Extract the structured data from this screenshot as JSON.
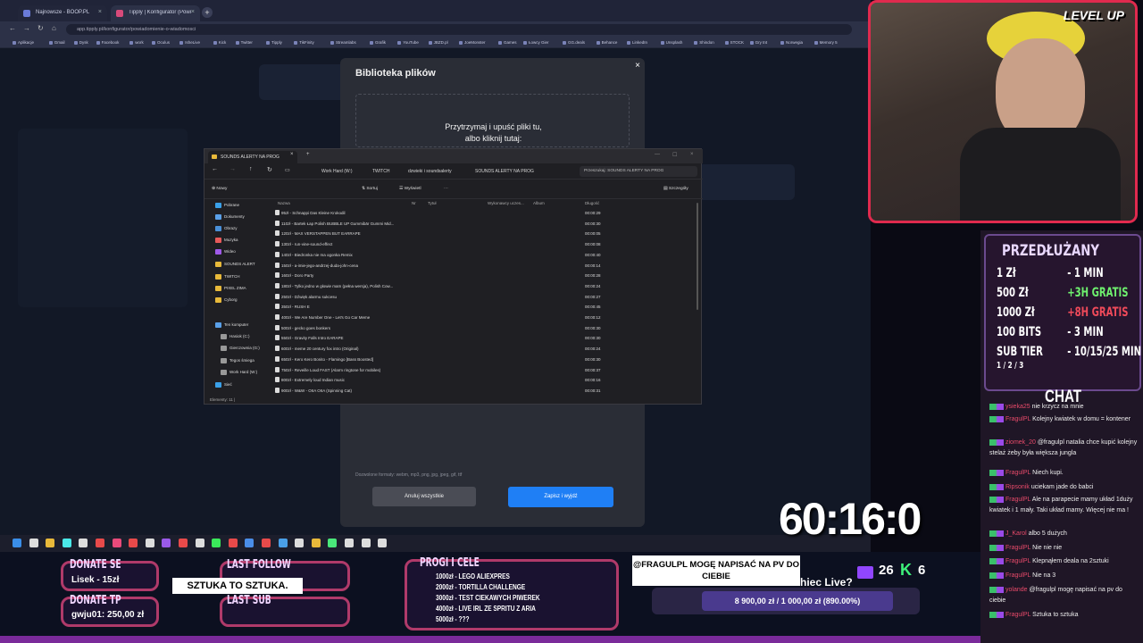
{
  "browser": {
    "tabs": [
      {
        "label": "Najnowsze - BOOP.PL"
      },
      {
        "label": "Tipply | Konfigurator (Powiadomienia)"
      }
    ],
    "url": "app.tipply.pl/konfigurator/powiadomienie-o-wiadomosci",
    "bookmarks": [
      "Aplikacje",
      "Gmail",
      "Dysk",
      "Facebook",
      "work",
      "Oculus",
      "IsheLive",
      "Kick",
      "Twitter",
      "Tipply",
      "TikFinity",
      "Streamlabs",
      "Grafik",
      "YouTube",
      "JBZD.pl",
      "JoeMonster",
      "Games",
      "Łowcy Gier",
      "GG.deals",
      "Behance",
      "LinkedIn",
      "Unsplash",
      "Shindon",
      "STOCK",
      "Gry tnt",
      "Norwegia",
      "Memory 5"
    ]
  },
  "modal": {
    "title": "Biblioteka plików",
    "close": "×",
    "drop_line1": "Przytrzymaj i upuść pliki tu,",
    "drop_line2": "albo kliknij tutaj:",
    "formats": "Dozwolone formaty: webm, mp3, png, jpg, jpeg, gif, ttf",
    "cancel": "Anuluj wszystkie",
    "save": "Zapisz i wyjdź"
  },
  "explorer": {
    "tab_title": "SOUNDS ALERTY NA PROG",
    "breadcrumbs": [
      "Work Hard (W:)",
      "TWITCH",
      "dzwieki i soundsalerty",
      "SOUNDS ALERTY NA PROG"
    ],
    "search_placeholder": "Przeszukaj: SOUNDS ALERTY NA PROG",
    "toolbar": {
      "new": "Nowy",
      "sort": "Sortuj",
      "view": "Wyświetl",
      "more": "···",
      "details": "Szczegóły"
    },
    "nav": [
      "Pobrane",
      "Dokumenty",
      "Obrazy",
      "Muzyka",
      "Wideo",
      "SOUNDS ALERT",
      "TWITCH",
      "PIXEL ZIMA",
      "Cyborg",
      "Ten komputer",
      "Hasiok (C:)",
      "Gierczownia (G:)",
      "Tegos śmiega",
      "Work Hard (W:)",
      "Sieć"
    ],
    "columns": [
      "Nazwa",
      "Nr",
      "Tytuł",
      "Wykonawcy uczes...",
      "Album",
      "Długość"
    ],
    "files": [
      {
        "name": "95zł - Schnappi Das Kleine Krokodil",
        "dur": "00:00:29"
      },
      {
        "name": "110zł - Bartek Łap Polish BUBBLE UP Gummibär Gummi Mid...",
        "dur": "00:00:30"
      },
      {
        "name": "120zł - MAX VERSTAPPEN BUT EARRAPE",
        "dur": "00:00:05"
      },
      {
        "name": "130zł - run-vine-sound-effect",
        "dur": "00:00:08"
      },
      {
        "name": "140zł - Biedronka nie ma ogonka Remix",
        "dur": "00:00:40"
      },
      {
        "name": "150zł - a-imie-jego-andrzej-duda-john-cena",
        "dur": "00:00:14"
      },
      {
        "name": "160zł - Doro Party",
        "dur": "00:00:28"
      },
      {
        "name": "180zł - Tylko jedno w głowie mam (pełna wersja), Polish Cow...",
        "dur": "00:00:24"
      },
      {
        "name": "250zł - Dźwięk alarmu sukcesu",
        "dur": "00:00:27"
      },
      {
        "name": "350zł - RUSH E",
        "dur": "00:00:45"
      },
      {
        "name": "400zł - We Are Number One - Let's Go Car Meme",
        "dur": "00:00:12"
      },
      {
        "name": "500zł - gecko goes bonkers",
        "dur": "00:00:30"
      },
      {
        "name": "550zł - Gravity Falls Intro EARAPE",
        "dur": "00:00:30"
      },
      {
        "name": "600zł - meme 20 century fox intro (Original)",
        "dur": "00:00:24"
      },
      {
        "name": "650zł - Kero Kero Bonito - Flamingo [Bass Boosted]",
        "dur": "00:00:30"
      },
      {
        "name": "750zł - Reveille Loud FAST (Alarm ringtone for mobiles)",
        "dur": "00:00:37"
      },
      {
        "name": "800zł - Extremely loud Indian music",
        "dur": "00:00:16"
      },
      {
        "name": "900zł - W&W - OIIA OIIA (Spinning Cat)",
        "dur": "00:00:31"
      }
    ],
    "status": "Elementy: 11  |"
  },
  "stream": {
    "cam_logo": "LEVEL UP",
    "prz_title": "PRZEDŁUŻANY",
    "prz_rows": [
      {
        "k": "1 Zł",
        "v": "- 1 MIN"
      },
      {
        "k": "500 Zł",
        "v": "+3H GRATIS"
      },
      {
        "k": "1000 Zł",
        "v": "+8H GRATIS"
      },
      {
        "k": "100 BITS",
        "v": "- 3 MIN"
      },
      {
        "k": "SUB TIER",
        "v": "- 10/15/25 MIN"
      }
    ],
    "sub_tiers": "1 / 2 / 3",
    "chat_title": "CHAT",
    "chat": [
      {
        "user": "ysieka25",
        "msg": "nie krzycz na mnie"
      },
      {
        "user": "FragulPL",
        "msg": "Kolejny kwiatek w domu = kontener"
      },
      {
        "user": "ziomek_20",
        "msg": "@fragulpl natalia chce kupić kolejny stelaż żeby była większa jungla"
      },
      {
        "user": "FragulPL",
        "msg": "Niech kupi."
      },
      {
        "user": "Ripsonik",
        "msg": "uciekam jade do babci"
      },
      {
        "user": "FragulPL",
        "msg": "Ale na parapecie mamy układ 1duży kwiatek i 1 mały. Taki układ mamy. Więcej nie ma !"
      },
      {
        "user": "J_Karol",
        "msg": "albo 5 dużych"
      },
      {
        "user": "FragulPL",
        "msg": "Nie nie nie"
      },
      {
        "user": "FragulPL",
        "msg": "Klepnąłem deala na 2sztuki"
      },
      {
        "user": "FragulPL",
        "msg": "Nie na 3"
      },
      {
        "user": "yolande",
        "msg": "@fragulpl mogę napisać na pv do ciebie"
      },
      {
        "user": "FragulPL",
        "msg": "Sztuka to sztuka"
      }
    ],
    "timer": "60:16:0",
    "donate_se": "DONATE SE",
    "donate_se_val": "Lisek - 15zł",
    "donate_tp": "DONATE TP",
    "donate_tp_val": "gwju01: 250,00 zł",
    "last_follow": "LAST FOLLOW",
    "last_sub": "LAST SUB",
    "sztuka": "SZTUKA TO SZTUKA.",
    "goals_title": "PROGI I CELE",
    "goals": [
      "1000zł - LEGO ALIEXPRES",
      "2000zł - TORTILLA CHALLENGE",
      "3000zł - TEST CIEKAWYCH PIWEREK",
      "4000zł - LIVE IRL ZE SPRITU Z ARIA",
      "5000zł - ???"
    ],
    "alert_msg": "@FRAGULPL MOGĘ NAPISAĆ NA PV DO CIEBIE",
    "hype_progress": "8 900,00 zł / 1 000,00 zł (890.00%)",
    "counter_a": "26",
    "counter_b": "6",
    "live_q": "hiec Live?"
  }
}
